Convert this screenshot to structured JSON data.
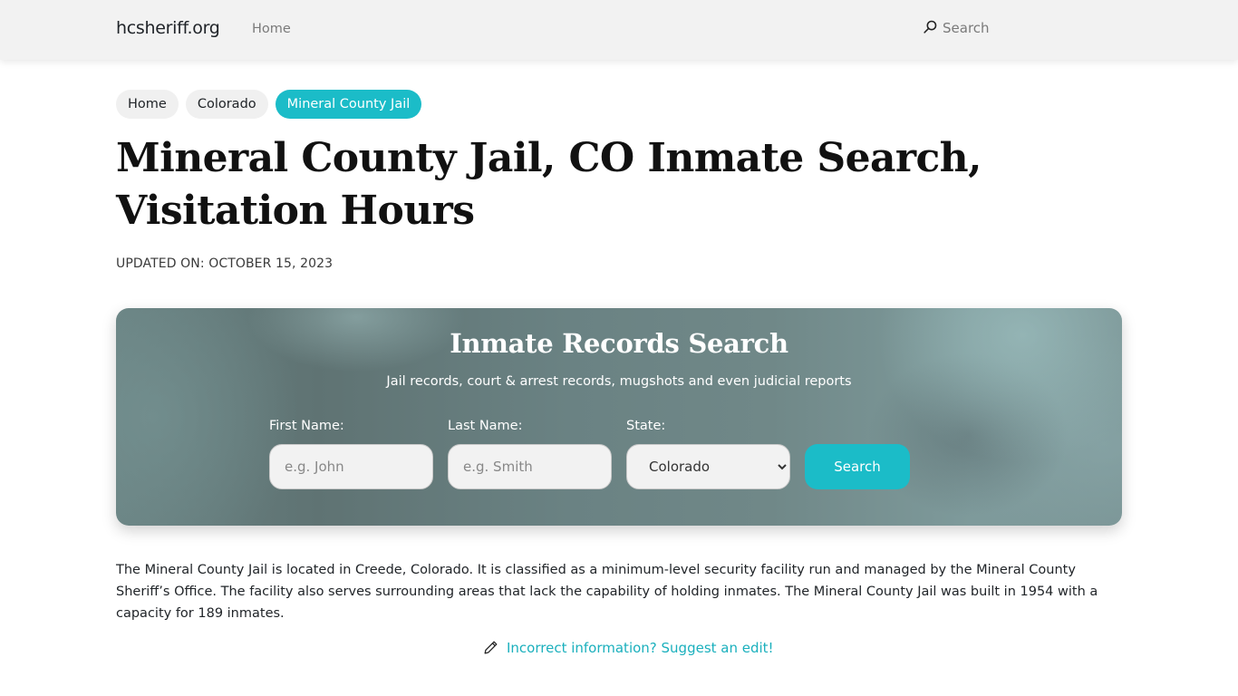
{
  "header": {
    "brand": "hcsheriff.org",
    "nav": [
      {
        "label": "Home"
      }
    ],
    "search_label": "Search",
    "search_icon": "search-icon"
  },
  "breadcrumb": [
    {
      "label": "Home",
      "active": false
    },
    {
      "label": "Colorado",
      "active": false
    },
    {
      "label": "Mineral County Jail",
      "active": true
    }
  ],
  "page": {
    "title": "Mineral County Jail, CO Inmate Search, Visitation Hours",
    "updated": "UPDATED ON: OCTOBER 15, 2023"
  },
  "search_panel": {
    "title": "Inmate Records Search",
    "subtitle": "Jail records, court & arrest records, mugshots and even judicial reports",
    "first_name": {
      "label": "First Name:",
      "value": "",
      "placeholder": "e.g. John"
    },
    "last_name": {
      "label": "Last Name:",
      "value": "",
      "placeholder": "e.g. Smith"
    },
    "state": {
      "label": "State:",
      "selected": "Colorado"
    },
    "button_label": "Search"
  },
  "content": {
    "description": "The Mineral County Jail is located in Creede, Colorado. It is classified as a minimum-level security facility run and managed by the Mineral County Sheriff’s Office. The facility also serves surrounding areas that lack the capability of holding inmates. The Mineral County Jail was built in 1954 with a capacity for 189 inmates.",
    "suggest_edit": "Incorrect information? Suggest an edit!",
    "suggest_edit_icon": "pencil-icon"
  },
  "colors": {
    "accent": "#1bbcc8",
    "link": "#1bb0bd",
    "navbar_bg": "#f2f2f2",
    "crumb_bg": "#f0f0f0"
  }
}
